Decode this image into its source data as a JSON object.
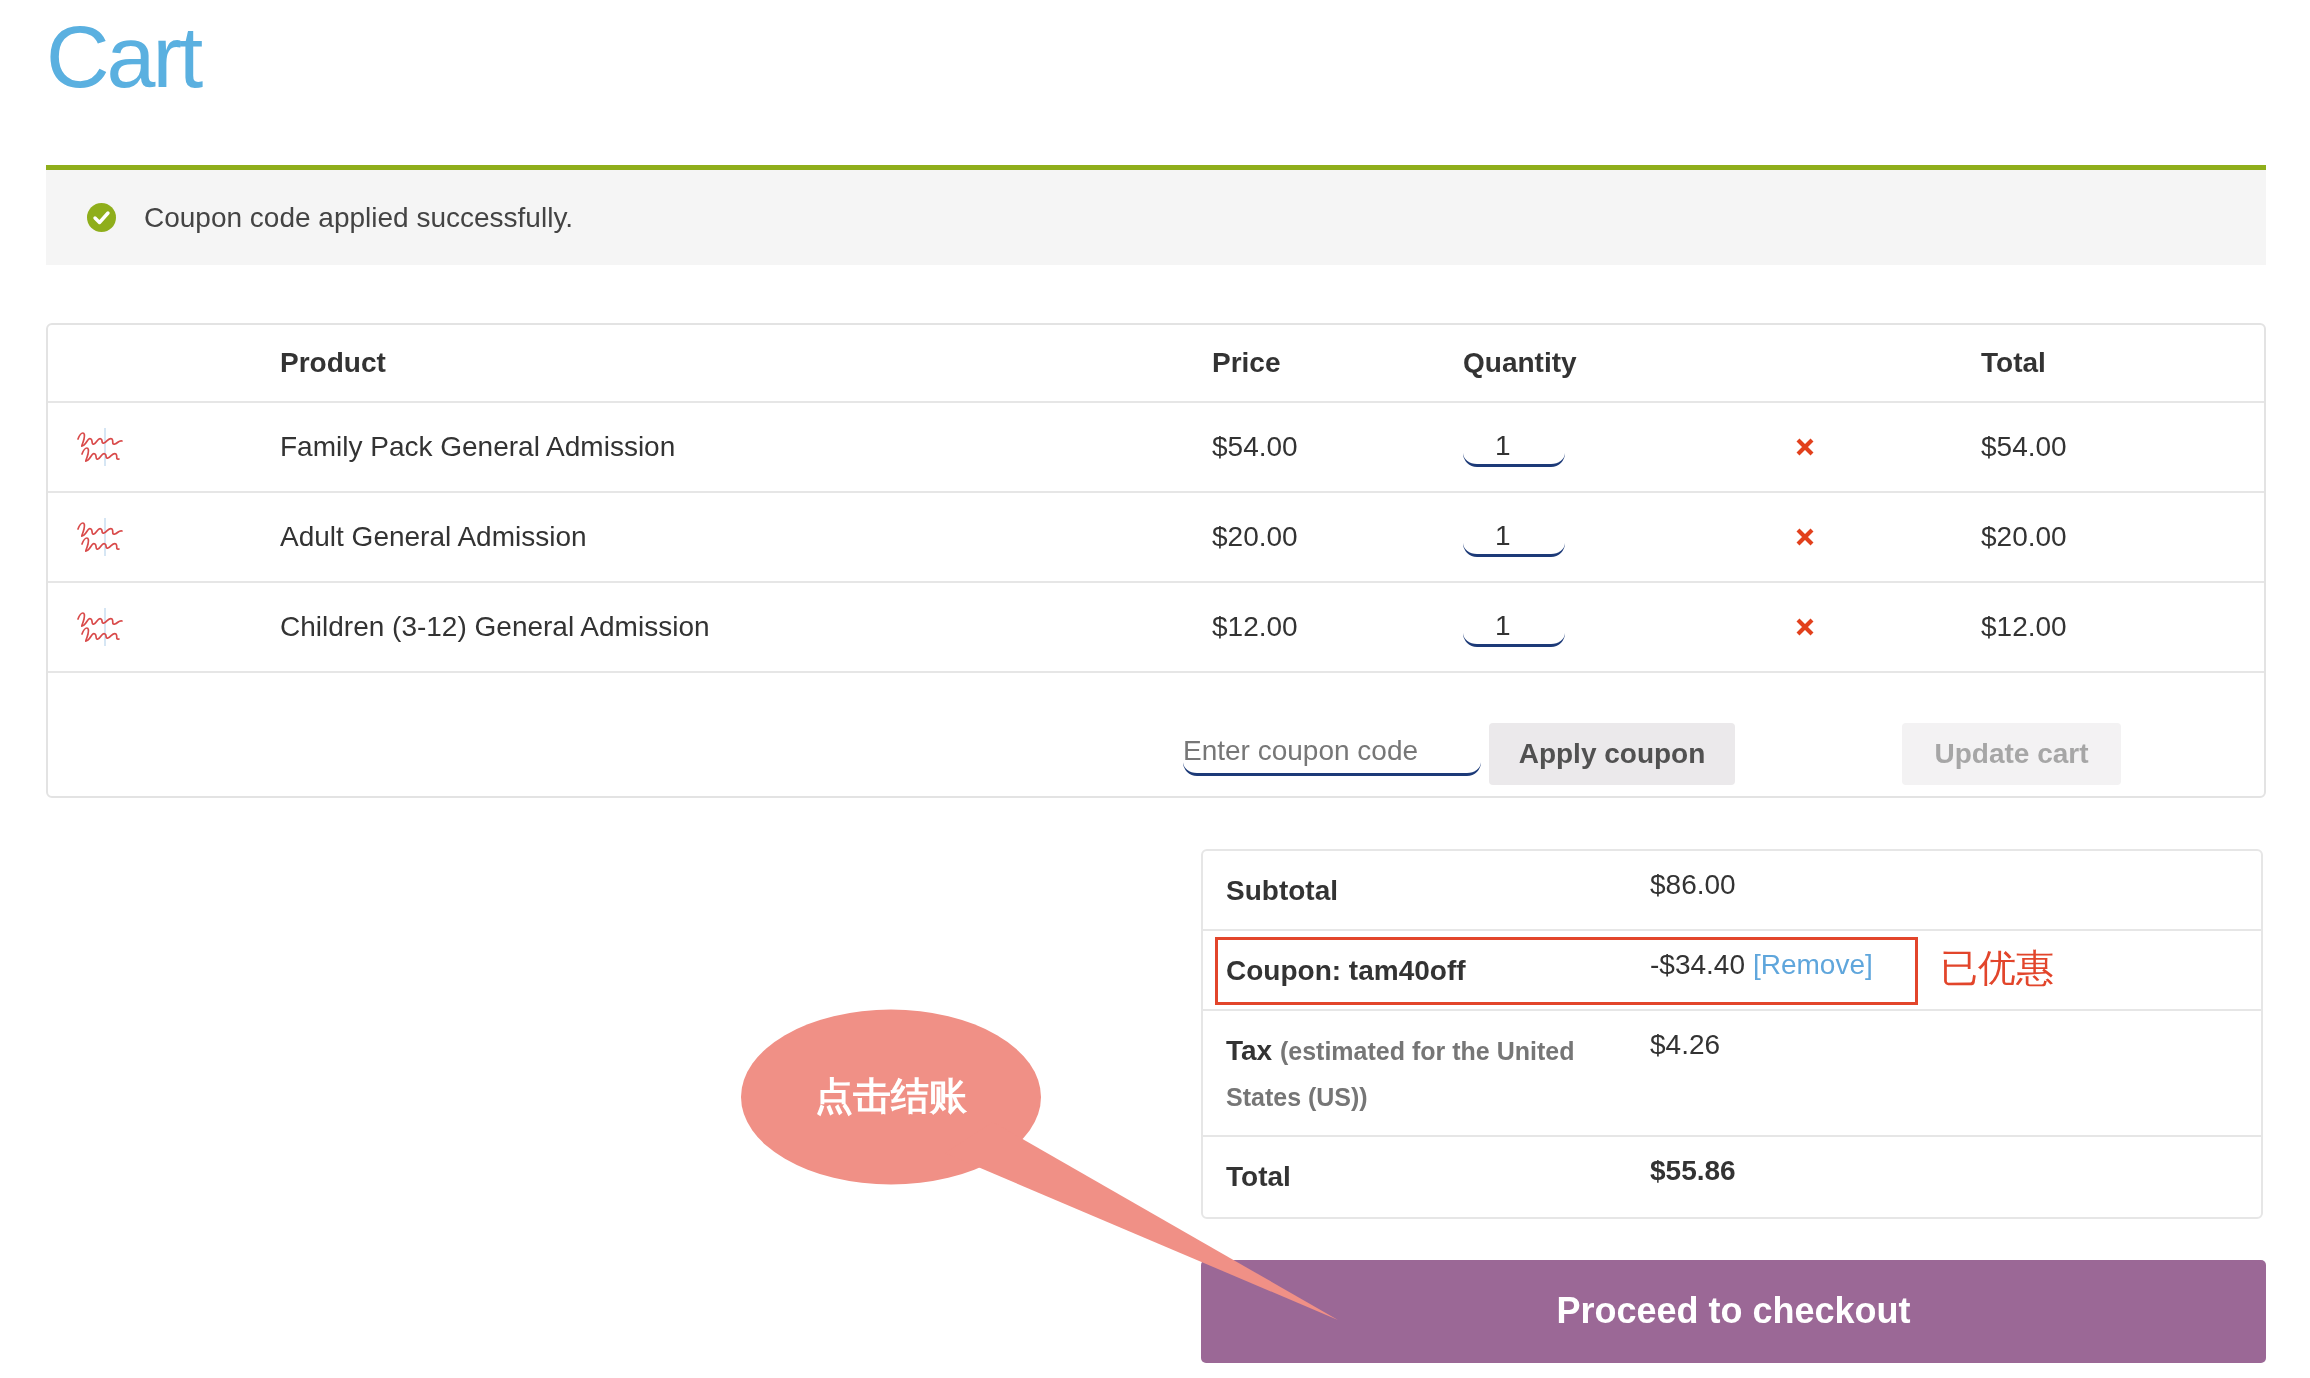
{
  "page": {
    "title": "Cart"
  },
  "notice": {
    "kind": "success",
    "message": "Coupon code applied successfully."
  },
  "cart_table": {
    "columns": [
      "Product",
      "Price",
      "Quantity",
      "Total"
    ],
    "rows": [
      {
        "product": "Family Pack General Admission",
        "price": "$54.00",
        "quantity": "1",
        "total": "$54.00"
      },
      {
        "product": "Adult General Admission",
        "price": "$20.00",
        "quantity": "1",
        "total": "$20.00"
      },
      {
        "product": "Children (3-12) General Admission",
        "price": "$12.00",
        "quantity": "1",
        "total": "$12.00"
      }
    ]
  },
  "coupon": {
    "placeholder": "Enter coupon code",
    "apply_button": "Apply coupon"
  },
  "update_button": {
    "label": "Update cart",
    "disabled": true
  },
  "totals": {
    "rows": [
      {
        "kind": "plain",
        "label": "Subtotal",
        "value": "$86.00",
        "highlighted": false
      },
      {
        "kind": "coupon",
        "label": "Coupon: tam40off",
        "value": "-$34.40",
        "link": "[Remove]",
        "highlighted": true,
        "annotation": "已优惠"
      },
      {
        "kind": "tax",
        "label": "Tax",
        "note": "(estimated for the United States (US))",
        "value": "$4.26",
        "highlighted": false
      },
      {
        "kind": "total",
        "label": "Total",
        "value": "$55.86",
        "highlighted": false
      }
    ]
  },
  "checkout_button": {
    "label": "Proceed to checkout"
  },
  "callout": {
    "text": "点击结账"
  }
}
